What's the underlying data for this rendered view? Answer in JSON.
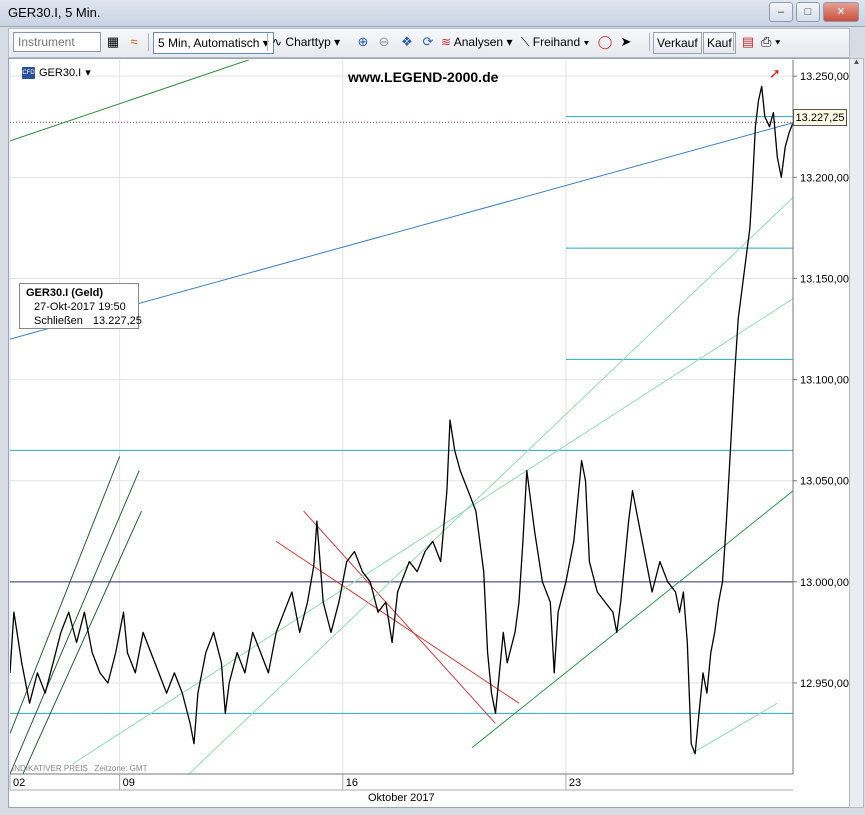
{
  "window": {
    "title": "GER30.I, 5 Min."
  },
  "toolbar": {
    "instrument_placeholder": "Instrument",
    "timeframe": "5 Min,  Automatisch",
    "charttype": "Charttyp",
    "analysis": "Analysen",
    "freehand": "Freihand",
    "sell": "Verkauf",
    "buy": "Kauf"
  },
  "chart": {
    "instrument": "GER30.I",
    "watermark": "www.LEGEND-2000.de",
    "footnote_1": "INDIKATIVER PREIS",
    "footnote_2": "Zeitzone: GMT",
    "month_label": "Oktober 2017",
    "last_price_label": "13.227,25",
    "info": {
      "header": "GER30.I (Geld)",
      "datetime": "27-Okt-2017 19:50",
      "close_label": "Schließen",
      "close_value": "13.227,25"
    }
  },
  "chart_data": {
    "type": "line",
    "y_ticks": [
      {
        "value": 13250,
        "label": "13.250,00"
      },
      {
        "value": 13200,
        "label": "13.200,00"
      },
      {
        "value": 13150,
        "label": "13.150,00"
      },
      {
        "value": 13100,
        "label": "13.100,00"
      },
      {
        "value": 13050,
        "label": "13.050,00"
      },
      {
        "value": 13000,
        "label": "13.000,00"
      },
      {
        "value": 12950,
        "label": "12.950,00"
      }
    ],
    "ylim": [
      12905,
      13258
    ],
    "xlim": [
      0,
      100
    ],
    "x_ticks": [
      {
        "x": 0,
        "label": "02"
      },
      {
        "x": 14,
        "label": "09"
      },
      {
        "x": 42.5,
        "label": "16"
      },
      {
        "x": 71,
        "label": "23"
      }
    ],
    "last_price": 13227.25,
    "horizontal_levels": [
      {
        "value": 13230,
        "color": "#2aa8b8",
        "x_start": 71
      },
      {
        "value": 13165,
        "color": "#2aa8b8",
        "x_start": 71
      },
      {
        "value": 13110,
        "color": "#2aa8b8",
        "x_start": 71
      },
      {
        "value": 13065,
        "color": "#2aa8b8",
        "x_start": 0
      },
      {
        "value": 13000,
        "color": "#333366",
        "x_start": 0
      },
      {
        "value": 12935,
        "color": "#2aa8b8",
        "x_start": 0
      }
    ],
    "trendlines": [
      {
        "color": "#2a8a3a",
        "points": [
          [
            0,
            13218
          ],
          [
            35,
            13264
          ]
        ]
      },
      {
        "color": "#3b7fc4",
        "points": [
          [
            0,
            13120
          ],
          [
            100,
            13227
          ]
        ]
      },
      {
        "color": "#1f5f3a",
        "points": [
          [
            0,
            12925
          ],
          [
            14,
            13062
          ]
        ]
      },
      {
        "color": "#1f5f3a",
        "points": [
          [
            0,
            12905
          ],
          [
            16.5,
            13055
          ]
        ]
      },
      {
        "color": "#1f5f3a",
        "points": [
          [
            0.5,
            12895
          ],
          [
            16.8,
            13035
          ]
        ]
      },
      {
        "color": "#d43a3a",
        "points": [
          [
            34,
            13020
          ],
          [
            65,
            12940
          ]
        ]
      },
      {
        "color": "#d43a3a",
        "points": [
          [
            37.5,
            13035
          ],
          [
            62,
            12930
          ]
        ]
      },
      {
        "color": "#2a9a4a",
        "points": [
          [
            59,
            12918
          ],
          [
            100,
            13045
          ]
        ]
      },
      {
        "color": "#8de0b0",
        "points": [
          [
            21.5,
            12900
          ],
          [
            100,
            13190
          ]
        ]
      },
      {
        "color": "#8de0b0",
        "points": [
          [
            8,
            12910
          ],
          [
            100,
            13140
          ]
        ]
      },
      {
        "color": "#8de0b0",
        "points": [
          [
            87,
            12915
          ],
          [
            98,
            12940
          ]
        ]
      }
    ],
    "series": [
      {
        "color": "#000000",
        "points": [
          [
            0,
            12955
          ],
          [
            0.5,
            12985
          ],
          [
            1.5,
            12960
          ],
          [
            2.5,
            12940
          ],
          [
            3.5,
            12955
          ],
          [
            4.5,
            12945
          ],
          [
            5.5,
            12960
          ],
          [
            6.5,
            12975
          ],
          [
            7.5,
            12985
          ],
          [
            8.5,
            12970
          ],
          [
            9.5,
            12985
          ],
          [
            10.5,
            12965
          ],
          [
            11.5,
            12955
          ],
          [
            12.5,
            12950
          ],
          [
            13.5,
            12965
          ],
          [
            14,
            12975
          ],
          [
            14.5,
            12985
          ],
          [
            15,
            12965
          ],
          [
            16,
            12955
          ],
          [
            17,
            12975
          ],
          [
            18,
            12965
          ],
          [
            19,
            12955
          ],
          [
            20,
            12945
          ],
          [
            21,
            12955
          ],
          [
            22,
            12945
          ],
          [
            23,
            12930
          ],
          [
            23.5,
            12920
          ],
          [
            24,
            12945
          ],
          [
            25,
            12965
          ],
          [
            26,
            12975
          ],
          [
            27,
            12960
          ],
          [
            27.5,
            12935
          ],
          [
            28,
            12950
          ],
          [
            29,
            12965
          ],
          [
            30,
            12955
          ],
          [
            31,
            12975
          ],
          [
            32,
            12965
          ],
          [
            33,
            12955
          ],
          [
            34,
            12975
          ],
          [
            35,
            12985
          ],
          [
            36,
            12995
          ],
          [
            37,
            12975
          ],
          [
            38,
            12990
          ],
          [
            38.8,
            13008
          ],
          [
            39.2,
            13030
          ],
          [
            40,
            12990
          ],
          [
            41,
            12975
          ],
          [
            42,
            12990
          ],
          [
            43,
            13010
          ],
          [
            44,
            13015
          ],
          [
            45,
            13005
          ],
          [
            46,
            13000
          ],
          [
            47,
            12985
          ],
          [
            48,
            12990
          ],
          [
            48.8,
            12970
          ],
          [
            49.5,
            12995
          ],
          [
            50,
            13000
          ],
          [
            51,
            13010
          ],
          [
            52,
            13005
          ],
          [
            53,
            13015
          ],
          [
            54,
            13020
          ],
          [
            55,
            13010
          ],
          [
            55.8,
            13045
          ],
          [
            56.2,
            13080
          ],
          [
            56.8,
            13065
          ],
          [
            57.5,
            13055
          ],
          [
            58.5,
            13045
          ],
          [
            59.5,
            13035
          ],
          [
            60.5,
            13005
          ],
          [
            61,
            12965
          ],
          [
            61.5,
            12945
          ],
          [
            62,
            12935
          ],
          [
            62.5,
            12955
          ],
          [
            63,
            12975
          ],
          [
            63.5,
            12960
          ],
          [
            64.5,
            12975
          ],
          [
            65,
            12990
          ],
          [
            65.5,
            13020
          ],
          [
            66,
            13055
          ],
          [
            66.5,
            13040
          ],
          [
            67,
            13025
          ],
          [
            68,
            13000
          ],
          [
            69,
            12990
          ],
          [
            69.5,
            12955
          ],
          [
            70,
            12985
          ],
          [
            71,
            13000
          ],
          [
            72,
            13020
          ],
          [
            73,
            13060
          ],
          [
            73.5,
            13050
          ],
          [
            74,
            13010
          ],
          [
            75,
            12995
          ],
          [
            76,
            12990
          ],
          [
            77,
            12985
          ],
          [
            77.5,
            12975
          ],
          [
            78,
            12990
          ],
          [
            78.5,
            13010
          ],
          [
            79,
            13030
          ],
          [
            79.5,
            13045
          ],
          [
            80,
            13035
          ],
          [
            81,
            13015
          ],
          [
            82,
            12995
          ],
          [
            83,
            13010
          ],
          [
            84,
            13000
          ],
          [
            85,
            12995
          ],
          [
            85.5,
            12985
          ],
          [
            86,
            12995
          ],
          [
            86.5,
            12970
          ],
          [
            87,
            12920
          ],
          [
            87.5,
            12915
          ],
          [
            88,
            12935
          ],
          [
            88.5,
            12955
          ],
          [
            89,
            12945
          ],
          [
            89.5,
            12965
          ],
          [
            90,
            12975
          ],
          [
            90.5,
            12990
          ],
          [
            91,
            13000
          ],
          [
            91.5,
            13030
          ],
          [
            92,
            13065
          ],
          [
            92.5,
            13100
          ],
          [
            93,
            13130
          ],
          [
            93.5,
            13145
          ],
          [
            94,
            13160
          ],
          [
            94.5,
            13175
          ],
          [
            94.8,
            13195
          ],
          [
            95.2,
            13225
          ],
          [
            95.6,
            13238
          ],
          [
            96,
            13245
          ],
          [
            96.4,
            13230
          ],
          [
            97,
            13225
          ],
          [
            97.5,
            13232
          ],
          [
            98,
            13210
          ],
          [
            98.5,
            13200
          ],
          [
            99,
            13215
          ],
          [
            99.5,
            13222
          ],
          [
            100,
            13227
          ]
        ]
      }
    ],
    "grid": true
  }
}
